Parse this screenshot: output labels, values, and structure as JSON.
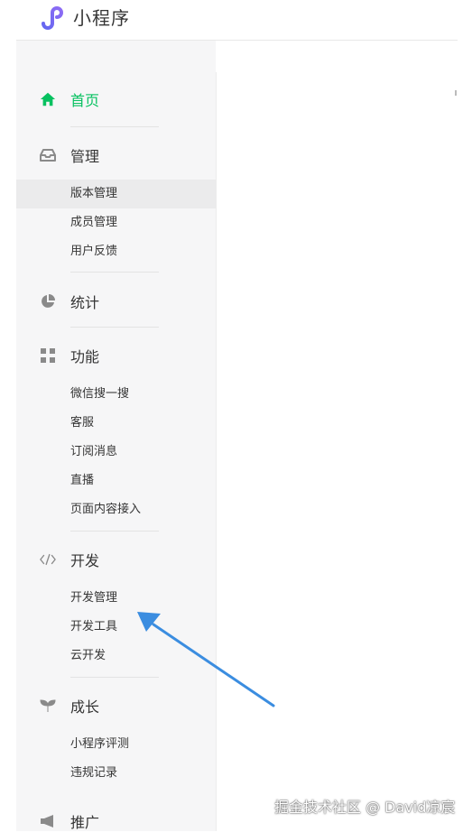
{
  "app": {
    "title": "小程序"
  },
  "nav": {
    "home": "首页",
    "manage": {
      "label": "管理",
      "items": [
        "版本管理",
        "成员管理",
        "用户反馈"
      ]
    },
    "stats": "统计",
    "features": {
      "label": "功能",
      "items": [
        "微信搜一搜",
        "客服",
        "订阅消息",
        "直播",
        "页面内容接入"
      ]
    },
    "dev": {
      "label": "开发",
      "items": [
        "开发管理",
        "开发工具",
        "云开发"
      ]
    },
    "growth": {
      "label": "成长",
      "items": [
        "小程序评测",
        "违规记录"
      ]
    },
    "promo": "推广"
  },
  "watermark": "掘金技术社区 @ David凉宸",
  "colors": {
    "accent": "#07c160",
    "icon_gray": "#8a8a8a",
    "arrow": "#3b8de0"
  }
}
